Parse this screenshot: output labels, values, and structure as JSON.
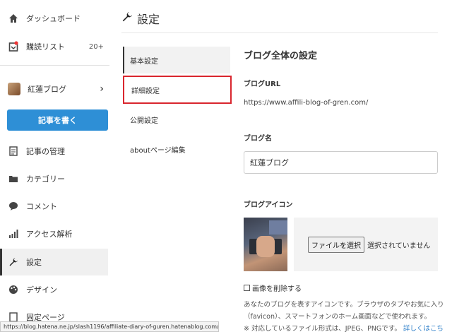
{
  "sidebar": {
    "items": [
      {
        "icon": "home-icon",
        "glyph": "⌂",
        "label": "ダッシュボード"
      },
      {
        "icon": "reading-list-icon",
        "glyph": "☐",
        "label": "購読リスト",
        "count": "20+"
      },
      {
        "icon": "blog-avatar-icon",
        "label": "紅蓮ブログ",
        "chevron": "›"
      },
      {
        "icon": "document-icon",
        "glyph": "▤",
        "label": "記事の管理"
      },
      {
        "icon": "folder-icon",
        "glyph": "■",
        "label": "カテゴリー"
      },
      {
        "icon": "comment-icon",
        "glyph": "●",
        "label": "コメント"
      },
      {
        "icon": "bar-chart-icon",
        "glyph": "▮",
        "label": "アクセス解析"
      },
      {
        "icon": "wrench-icon",
        "glyph": "🔧",
        "label": "設定"
      },
      {
        "icon": "palette-icon",
        "glyph": "◉",
        "label": "デザイン"
      },
      {
        "icon": "page-icon",
        "glyph": "▢",
        "label": "固定ページ"
      }
    ],
    "write_button": "記事を書く"
  },
  "header": {
    "title": "設定"
  },
  "subnav": {
    "items": [
      "基本設定",
      "詳細設定",
      "公開設定",
      "aboutページ編集"
    ]
  },
  "main": {
    "section_title": "ブログ全体の設定",
    "blog_url_label": "ブログURL",
    "blog_url_value": "https://www.affili-blog-of-gren.com/",
    "blog_name_label": "ブログ名",
    "blog_name_value": "紅蓮ブログ",
    "blog_icon_label": "ブログアイコン",
    "file_button": "ファイルを選択",
    "file_status": "選択されていません",
    "delete_checkbox": "画像を削除する",
    "help_line1": "あなたのブログを表すアイコンです。ブラウザのタブやお気に入り",
    "help_line2": "（favicon）、スマートフォンのホーム画面などで使われます。",
    "help_line3": "※ 対応しているファイル形式は、JPEG、PNGです。",
    "help_link": "詳しくはこちら"
  },
  "statusbar": {
    "url": "https://blog.hatena.ne.jp/slash1196/affiliate-diary-of-guren.hatenablog.com/config/detail"
  },
  "colors": {
    "accent": "#2e8fd6",
    "highlight": "#d9262e"
  }
}
